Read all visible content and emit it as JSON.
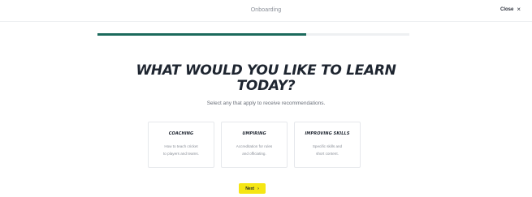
{
  "header": {
    "title": "Onboarding",
    "close_label": "Close",
    "close_icon": "close-icon"
  },
  "progress": {
    "value": 0.67
  },
  "main": {
    "heading_line1": "WHAT WOULD YOU LIKE TO LEARN",
    "heading_line2": "TODAY?",
    "subtitle": "Select any that apply to receive recommendations.",
    "options": [
      {
        "title": "COACHING",
        "desc1": "How to teach cricket",
        "desc2": "to players and teams."
      },
      {
        "title": "UMPIRING",
        "desc1": "Accreditation for rules",
        "desc2": "and officiating."
      },
      {
        "title": "IMPROVING SKILLS",
        "desc1": "Specific skills and",
        "desc2": "short content."
      }
    ],
    "next_label": "Next",
    "next_icon": "chevron-right-icon"
  },
  "colors": {
    "progress": "#1b6a5c",
    "accent": "#f5e614"
  }
}
